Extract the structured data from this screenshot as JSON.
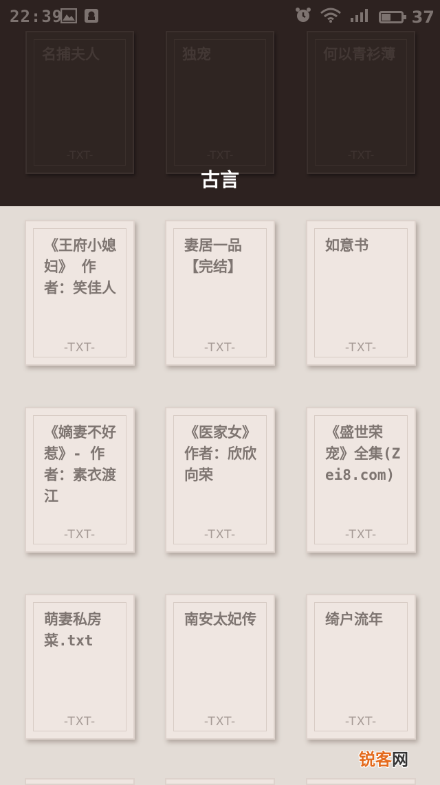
{
  "status_bar": {
    "time": "22:39",
    "battery_level": "37",
    "icons": [
      "gallery-icon",
      "notification-icon",
      "alarm-icon",
      "wifi-icon",
      "signal-icon",
      "battery-icon"
    ]
  },
  "header": {
    "category_title": "古言",
    "ghost_books": [
      {
        "title": "名捕夫人",
        "ext": "-TXT-"
      },
      {
        "title": "独宠",
        "ext": "-TXT-"
      },
      {
        "title": "何以青衫薄",
        "ext": "-TXT-"
      }
    ]
  },
  "books": [
    {
      "title": "《王府小媳妇》 作者：笑佳人",
      "ext": "-TXT-"
    },
    {
      "title": "妻居一品【完结】",
      "ext": "-TXT-"
    },
    {
      "title": "如意书",
      "ext": "-TXT-"
    },
    {
      "title": "《嫡妻不好惹》- 作者：素衣渡江",
      "ext": "-TXT-"
    },
    {
      "title": "《医家女》作者：欣欣向荣",
      "ext": "-TXT-"
    },
    {
      "title": "《盛世荣宠》全集(Zei8.com)",
      "ext": "-TXT-"
    },
    {
      "title": "萌妻私房菜.txt",
      "ext": "-TXT-"
    },
    {
      "title": "南安太妃传",
      "ext": "-TXT-"
    },
    {
      "title": "绮户流年",
      "ext": "-TXT-"
    }
  ],
  "watermark": {
    "part1": "锐客",
    "part2": "网"
  },
  "colors": {
    "header_bg": "#2d2220",
    "shelf_bg": "#e3dcd6",
    "book_bg": "#efe6e1",
    "title_text": "#7e7571",
    "watermark_orange": "#e46a1c"
  }
}
